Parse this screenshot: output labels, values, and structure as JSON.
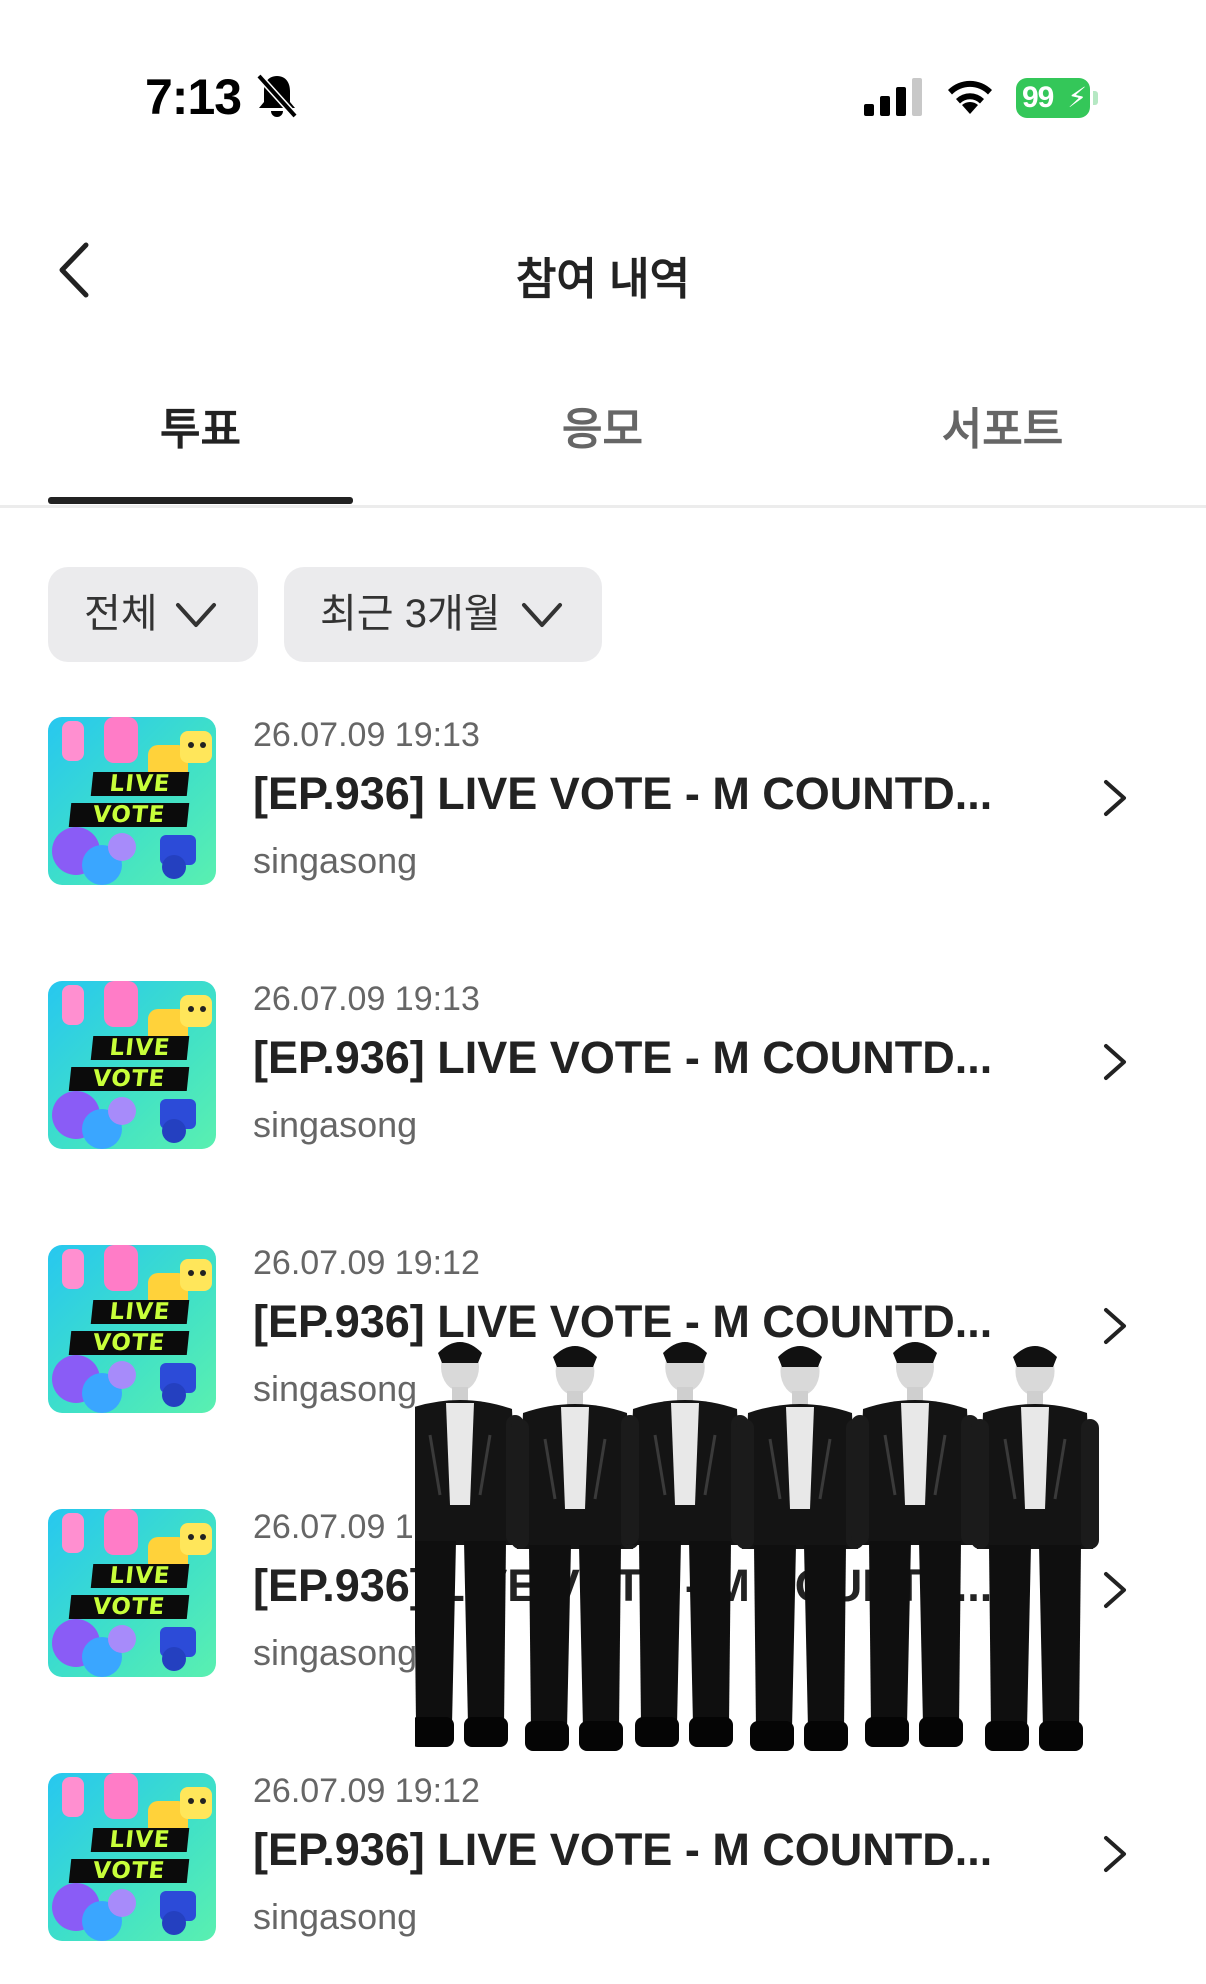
{
  "status_bar": {
    "time": "7:13",
    "battery": "99"
  },
  "header": {
    "title": "참여 내역"
  },
  "tabs": [
    {
      "label": "투표",
      "active": true
    },
    {
      "label": "응모",
      "active": false
    },
    {
      "label": "서포트",
      "active": false
    }
  ],
  "filters": {
    "category": "전체",
    "period": "최근 3개월"
  },
  "thumbnail": {
    "line1": "LIVE",
    "line2": "VOTE"
  },
  "items": [
    {
      "date": "26.07.09 19:13",
      "title": "[EP.936] LIVE VOTE - M COUNTD...",
      "source": "singasong"
    },
    {
      "date": "26.07.09 19:13",
      "title": "[EP.936] LIVE VOTE - M COUNTD...",
      "source": "singasong"
    },
    {
      "date": "26.07.09 19:12",
      "title": "[EP.936] LIVE VOTE - M COUNTD...",
      "source": "singasong"
    },
    {
      "date": "26.07.09 19:12",
      "title": "[EP.936] LIVE VOTE - M COUNTD...",
      "source": "singasong"
    },
    {
      "date": "26.07.09 19:12",
      "title": "[EP.936] LIVE VOTE - M COUNTD...",
      "source": "singasong"
    }
  ],
  "colors": {
    "accent": "#222222",
    "battery": "#34c759",
    "chip_bg": "#ebebed",
    "thumb_text": "#c8ff3a"
  }
}
